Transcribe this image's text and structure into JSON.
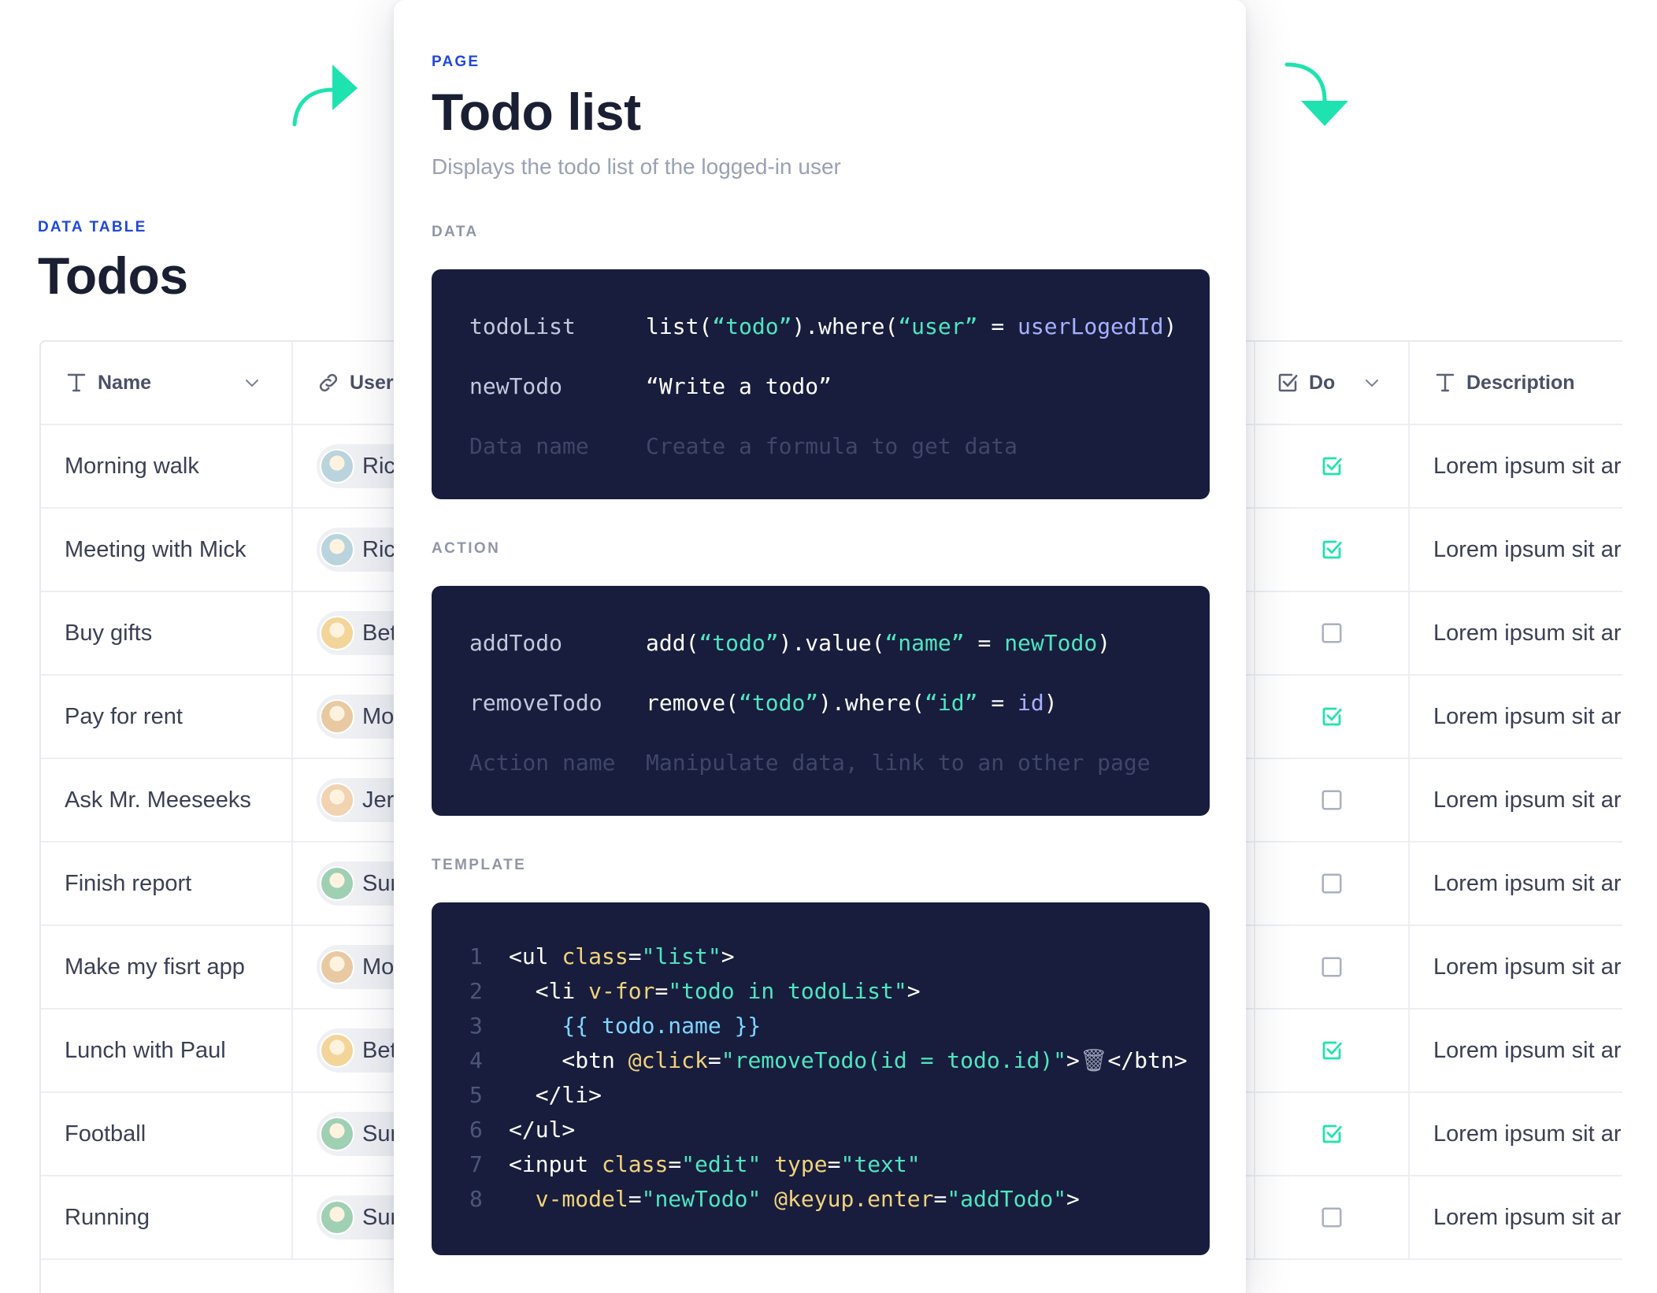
{
  "background": {
    "kicker": "DATA TABLE",
    "title": "Todos",
    "columns": {
      "name": "Name",
      "user": "User",
      "done": "Do",
      "description": "Description"
    },
    "rows": [
      {
        "name": "Morning walk",
        "user": "Rick",
        "done": true,
        "description": "Lorem ipsum sit ar"
      },
      {
        "name": "Meeting with Mick",
        "user": "Rick",
        "done": true,
        "description": "Lorem ipsum sit ar"
      },
      {
        "name": "Buy gifts",
        "user": "Bet",
        "done": false,
        "description": "Lorem ipsum sit ar"
      },
      {
        "name": "Pay for rent",
        "user": "Mo",
        "done": true,
        "description": "Lorem ipsum sit ar"
      },
      {
        "name": "Ask Mr. Meeseeks",
        "user": "Jer",
        "done": false,
        "description": "Lorem ipsum sit ar"
      },
      {
        "name": "Finish report",
        "user": "Sur",
        "done": false,
        "description": "Lorem ipsum sit ar"
      },
      {
        "name": "Make my fisrt app",
        "user": "Mo",
        "done": false,
        "description": "Lorem ipsum sit ar"
      },
      {
        "name": "Lunch with Paul",
        "user": "Bet",
        "done": true,
        "description": "Lorem ipsum sit ar"
      },
      {
        "name": "Football",
        "user": "Sur",
        "done": true,
        "description": "Lorem ipsum sit ar"
      },
      {
        "name": "Running",
        "user": "Sur",
        "done": false,
        "description": "Lorem ipsum sit ar"
      }
    ]
  },
  "panel": {
    "kicker": "PAGE",
    "title": "Todo list",
    "subtitle": "Displays the todo list of the logged-in user",
    "data_label": "DATA",
    "data": [
      {
        "name": "todoList",
        "formula": "list(“todo”).where(“user” = userLogedId)"
      },
      {
        "name": "newTodo",
        "formula": "“Write a todo”"
      }
    ],
    "data_placeholder": {
      "name": "Data name",
      "formula": "Create a formula to get data"
    },
    "action_label": "ACTION",
    "actions": [
      {
        "name": "addTodo",
        "formula": "add(“todo”).value(“name” = newTodo)"
      },
      {
        "name": "removeTodo",
        "formula": "remove(“todo”).where(“id” = id)"
      }
    ],
    "action_placeholder": {
      "name": "Action name",
      "formula": "Manipulate data, link to an other page"
    },
    "template_label": "TEMPLATE",
    "template_lines": [
      "<ul class=\"list\">",
      "  <li v-for=\"todo in todoList\">",
      "    {{ todo.name }}",
      "    <btn @click=\"removeTodo(id = todo.id)\">🗑</btn>",
      "  </li>",
      "</ul>",
      "<input class=\"edit\" type=\"text\"",
      "  v-model=\"newTodo\" @keyup.enter=\"addTodo\">"
    ]
  },
  "colors": {
    "accent": "#1f47e0",
    "teal": "#1ee3b0",
    "code_bg": "#181d3d"
  }
}
